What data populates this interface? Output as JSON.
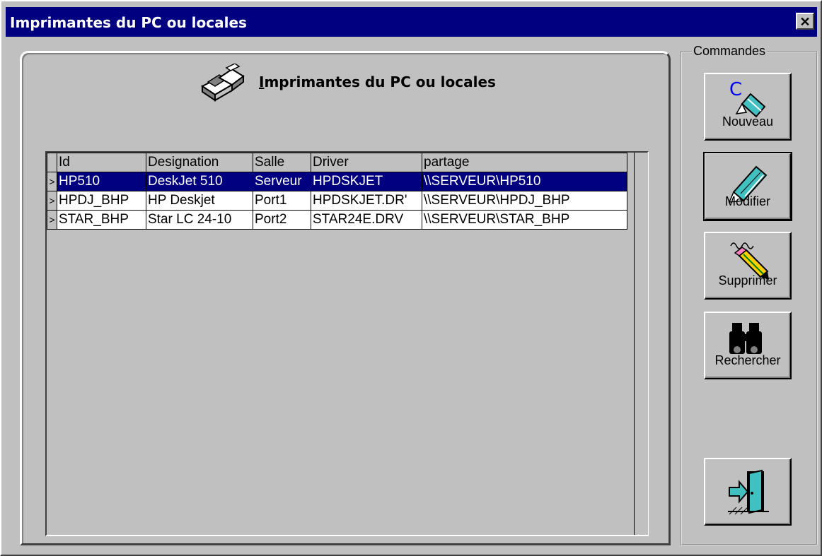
{
  "window": {
    "title": "Imprimantes du PC ou locales",
    "close_glyph": "✕"
  },
  "header": {
    "title_first": "I",
    "title_rest": "mprimantes du PC ou locales",
    "icon": "printer-icon"
  },
  "grid": {
    "columns": [
      "Id",
      "Designation",
      "Salle",
      "Driver",
      "partage"
    ],
    "rows": [
      {
        "indicator": ">",
        "id": "HP510",
        "designation": "DeskJet 510",
        "salle": "Serveur",
        "driver": "HPDSKJET",
        "partage": "\\\\SERVEUR\\HP510",
        "selected": true
      },
      {
        "indicator": ">",
        "id": "HPDJ_BHP",
        "designation": "HP Deskjet",
        "salle": "Port1",
        "driver": "HPDSKJET.DR'",
        "partage": "\\\\SERVEUR\\HPDJ_BHP",
        "selected": false
      },
      {
        "indicator": ">",
        "id": "STAR_BHP",
        "designation": "Star LC 24-10",
        "salle": "Port2",
        "driver": "STAR24E.DRV",
        "partage": "\\\\SERVEUR\\STAR_BHP",
        "selected": false
      }
    ]
  },
  "commands": {
    "group_label": "Commandes",
    "new_label": "Nouveau",
    "edit_label": "Modifier",
    "delete_label": "Supprimer",
    "search_label": "Rechercher",
    "new_icon": "pen-icon",
    "edit_icon": "pencil-icon",
    "delete_icon": "eraser-pencil-icon",
    "search_icon": "binoculars-icon",
    "exit_icon": "exit-door-icon"
  },
  "colors": {
    "selection": "#000080",
    "titlebar": "#000080",
    "face": "#c0c0c0"
  }
}
